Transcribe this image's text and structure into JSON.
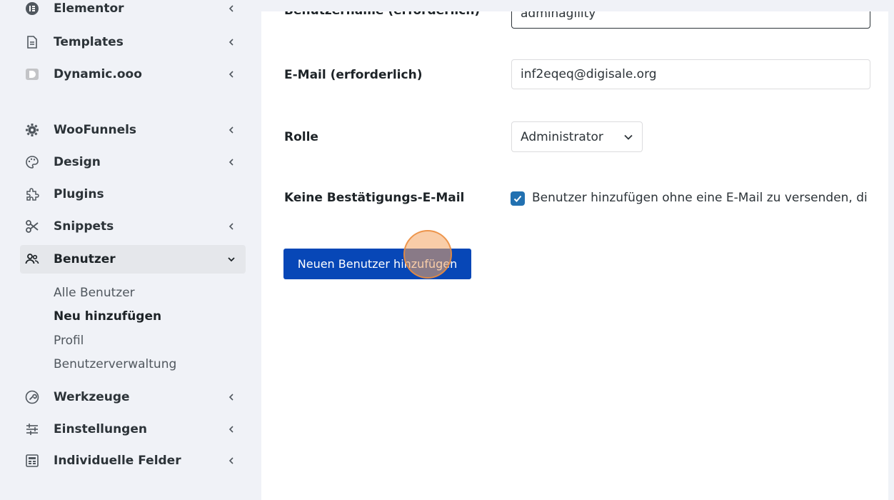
{
  "sidebar": {
    "items": [
      {
        "label": "Elementor",
        "icon": "elementor-icon",
        "has_chevron": true
      },
      {
        "label": "Templates",
        "icon": "document-icon",
        "has_chevron": true
      },
      {
        "label": "Dynamic.ooo",
        "icon": "dynamic-icon",
        "has_chevron": true
      },
      {
        "label": "WooFunnels",
        "icon": "gear-icon",
        "has_chevron": true
      },
      {
        "label": "Design",
        "icon": "palette-icon",
        "has_chevron": true
      },
      {
        "label": "Plugins",
        "icon": "plugin-icon",
        "has_chevron": false
      },
      {
        "label": "Snippets",
        "icon": "scissors-icon",
        "has_chevron": true
      },
      {
        "label": "Benutzer",
        "icon": "users-icon",
        "has_chevron": true,
        "active": true
      },
      {
        "label": "Werkzeuge",
        "icon": "wrench-icon",
        "has_chevron": true
      },
      {
        "label": "Einstellungen",
        "icon": "sliders-icon",
        "has_chevron": true
      },
      {
        "label": "Individuelle Felder",
        "icon": "fields-icon",
        "has_chevron": true
      }
    ],
    "submenu": [
      {
        "label": "Alle Benutzer",
        "current": false
      },
      {
        "label": "Neu hinzufügen",
        "current": true
      },
      {
        "label": "Profil",
        "current": false
      },
      {
        "label": "Benutzerverwaltung",
        "current": false
      }
    ]
  },
  "form": {
    "username": {
      "label": "Benutzername (erforderlich)",
      "value": "adminagility"
    },
    "email": {
      "label": "E-Mail (erforderlich)",
      "value": "inf2eqeq@digisale.org"
    },
    "role": {
      "label": "Rolle",
      "value": "Administrator"
    },
    "no_notification": {
      "label": "Keine Bestätigungs-E-Mail",
      "text": "Benutzer hinzufügen ohne eine E-Mail zu versenden, di",
      "checked": true
    },
    "submit_label": "Neuen Benutzer hinzufügen"
  },
  "colors": {
    "primary_button": "#0747b7",
    "checkbox": "#2271b1",
    "click_indicator": "#f4a460"
  }
}
